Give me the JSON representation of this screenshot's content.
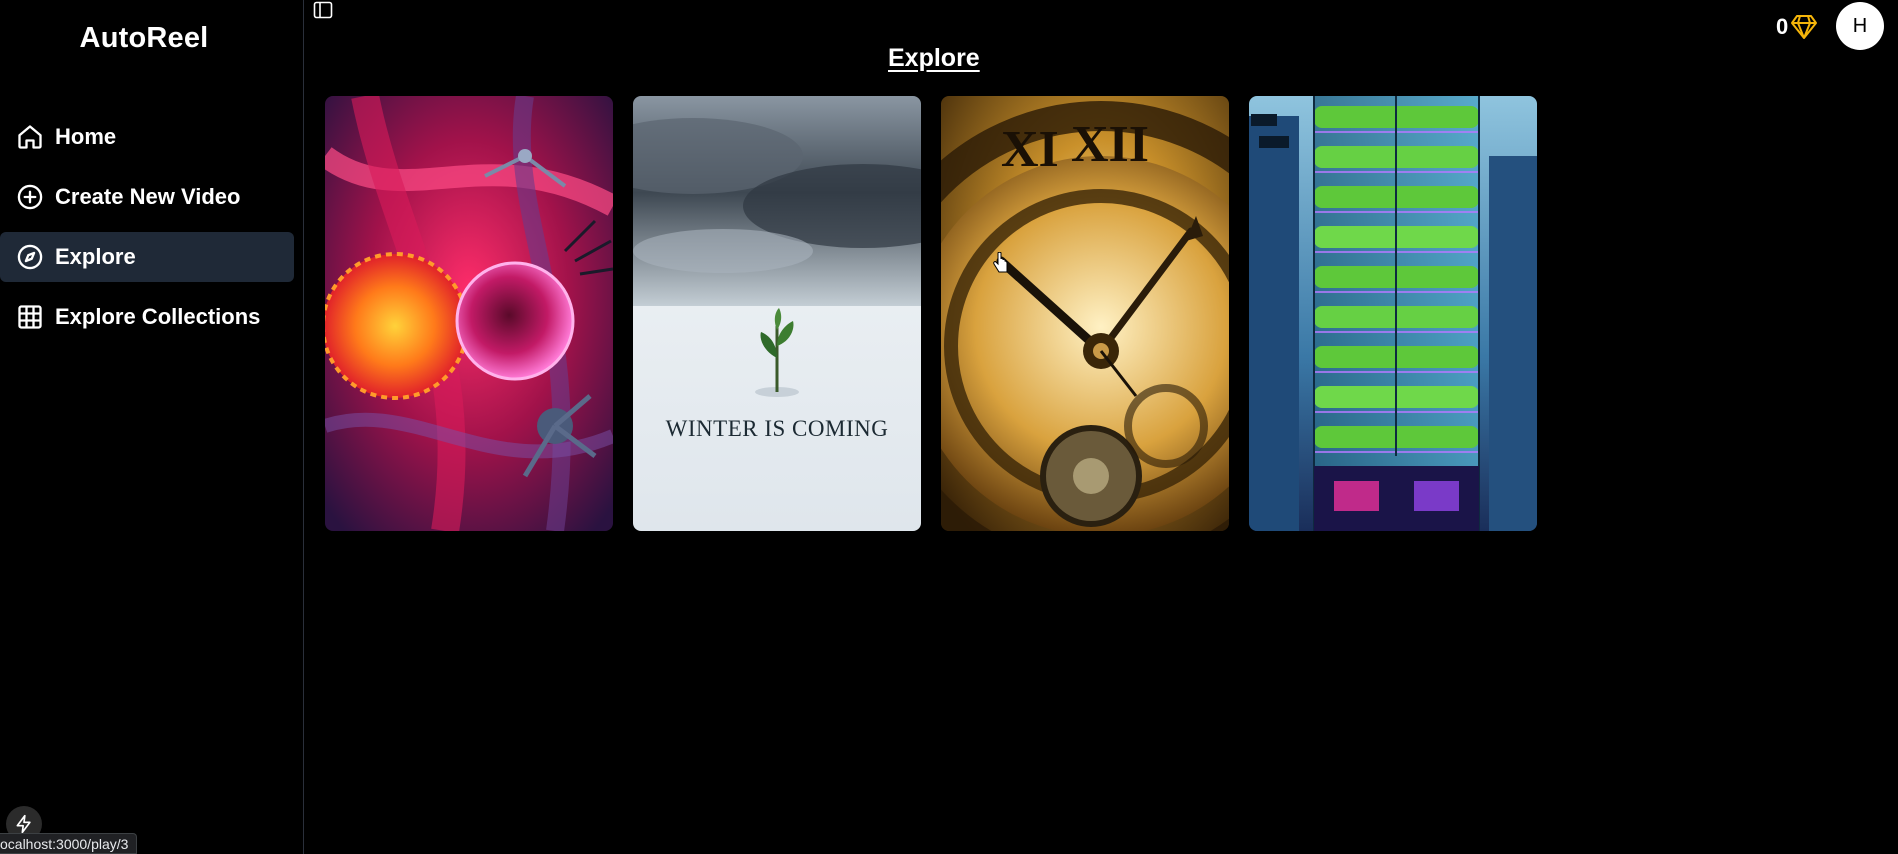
{
  "app": {
    "brand": "AutoReel"
  },
  "sidebar": {
    "items": [
      {
        "label": "Home",
        "icon": "home-icon",
        "active": false
      },
      {
        "label": "Create New Video",
        "icon": "plus-circle-icon",
        "active": false
      },
      {
        "label": "Explore",
        "icon": "compass-icon",
        "active": true
      },
      {
        "label": "Explore Collections",
        "icon": "grid-icon",
        "active": false
      }
    ]
  },
  "header": {
    "title": "Explore",
    "credits": "0",
    "credits_icon": "diamond-icon",
    "avatar_initial": "H"
  },
  "cards": [
    {
      "image": "cells-molecules-thumbnail",
      "text": ""
    },
    {
      "image": "winter-sprout-thumbnail",
      "text": "WINTER IS COMING"
    },
    {
      "image": "golden-clock-thumbnail",
      "text": ""
    },
    {
      "image": "vertical-farm-tower-thumbnail",
      "text": ""
    }
  ],
  "status_bar": {
    "url": "ocalhost:3000/play/3"
  },
  "colors": {
    "background": "#000000",
    "active_nav": "#1f2937",
    "accent_diamond": "#f5b50a"
  }
}
